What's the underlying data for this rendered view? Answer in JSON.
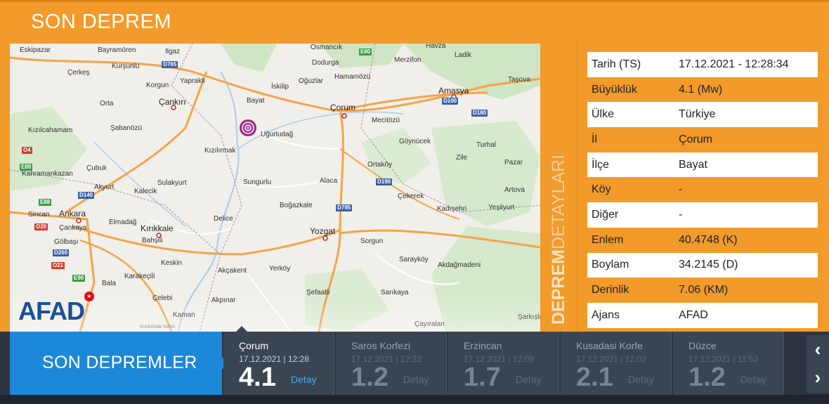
{
  "header": {
    "title": "SON DEPREM"
  },
  "map": {
    "logo_text": "AFAD",
    "epicenter_label": "Uğurludağ",
    "cities": [
      {
        "name": "Çankırı",
        "kind": "city"
      },
      {
        "name": "Çorum",
        "kind": "city"
      },
      {
        "name": "Amasya",
        "kind": "city"
      },
      {
        "name": "Ankara",
        "kind": "city"
      },
      {
        "name": "Kırıkkale",
        "kind": "city"
      },
      {
        "name": "Yozgat",
        "kind": "city"
      }
    ],
    "towns": [
      "Eskipazar",
      "Bayramören",
      "Ilgaz",
      "Osmancık",
      "Havza",
      "Ladik",
      "Çerkeş",
      "Kurşunlu",
      "Dodurga",
      "Merzifon",
      "Yapraklı",
      "Korgun",
      "Hamamözü",
      "İskilip",
      "Oğuzlar",
      "Taşova",
      "Orta",
      "Bayat",
      "Mecitözü",
      "Kızılcahamam",
      "Şabanözü",
      "Göynücek",
      "Turhal",
      "Kızılırmak",
      "Zile",
      "Ortaköy",
      "Pazar",
      "Kahramankazan",
      "Çubuk",
      "Sulakyurt",
      "Sungurlu",
      "Alaca",
      "Akyurt",
      "Kalecik",
      "Artova",
      "Çekerek",
      "Boğazkale",
      "Kadışehri",
      "Yeşilyurt",
      "Sincan",
      "Çankaya",
      "Elmadağ",
      "Delice",
      "Gölbaşı",
      "Bahşili",
      "Sorgun",
      "Keskin",
      "Sarayköy",
      "Akdağmadeni",
      "Akçakent",
      "Yerköy",
      "Bala",
      "Karakeçili",
      "Şefaatli",
      "Sarıkaya",
      "Çelebi",
      "Akpınar",
      "Kaman",
      "Çayıralan",
      "Şarkışla",
      "Kızılırmak Nehri"
    ],
    "roads": [
      "D765",
      "E80",
      "D100",
      "D180",
      "E89",
      "O4",
      "E88",
      "D140",
      "D190",
      "D795",
      "O20",
      "D260",
      "O21",
      "E90"
    ]
  },
  "side_label": {
    "strong": "DEPREM",
    "light": "DETAYLARI"
  },
  "details": [
    {
      "key": "Tarih (TS)",
      "value": "17.12.2021 - 12:28:34"
    },
    {
      "key": "Büyüklük",
      "value": "4.1 (Mw)"
    },
    {
      "key": "Ülke",
      "value": "Türkiye"
    },
    {
      "key": "İl",
      "value": "Çorum"
    },
    {
      "key": "İlçe",
      "value": "Bayat"
    },
    {
      "key": "Köy",
      "value": "-"
    },
    {
      "key": "Diğer",
      "value": "-"
    },
    {
      "key": "Enlem",
      "value": "40.4748 (K)"
    },
    {
      "key": "Boylam",
      "value": "34.2145 (D)"
    },
    {
      "key": "Derinlik",
      "value": "7.06 (KM)"
    },
    {
      "key": "Ajans",
      "value": "AFAD"
    }
  ],
  "recent": {
    "title": "SON DEPREMLER",
    "detail_label": "Detay",
    "items": [
      {
        "place": "Çorum",
        "time": "17.12.2021 | 12:28",
        "mag": "4.1"
      },
      {
        "place": "Saros Korfezi",
        "time": "17.12.2021 | 12:22",
        "mag": "1.2"
      },
      {
        "place": "Erzincan",
        "time": "17.12.2021 | 12:09",
        "mag": "1.7"
      },
      {
        "place": "Kusadasi Korfe",
        "time": "17.12.2021 | 12:02",
        "mag": "2.1"
      },
      {
        "place": "Düzce",
        "time": "17.12.2021 | 11:53",
        "mag": "1.2"
      }
    ],
    "prev_icon": "chevron-left-icon",
    "next_icon": "chevron-right-icon"
  }
}
